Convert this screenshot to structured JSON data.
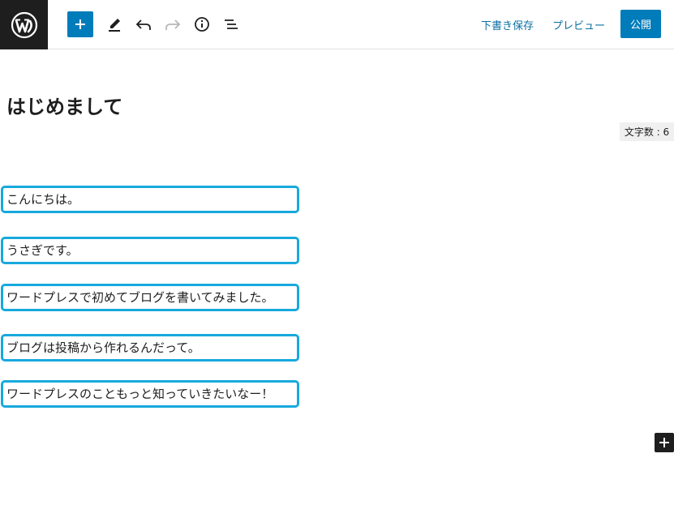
{
  "toolbar": {
    "save_draft_label": "下書き保存",
    "preview_label": "プレビュー",
    "publish_label": "公開",
    "icons": [
      "wordpress-logo-icon",
      "plus-icon",
      "pencil-icon",
      "undo-icon",
      "redo-icon",
      "info-icon",
      "list-view-icon"
    ]
  },
  "post": {
    "title": "はじめまして",
    "char_count": "文字数 : 6",
    "paragraphs": [
      "こんにちは。",
      "うさぎです。",
      "ワードプレスで初めてブログを書いてみました。",
      "ブログは投稿から作れるんだって。",
      "ワードプレスのこともっと知っていきたいなー！"
    ]
  },
  "colors": {
    "accent": "#007cba",
    "highlight_border": "#17a9dd",
    "dark": "#1e1e1e"
  }
}
